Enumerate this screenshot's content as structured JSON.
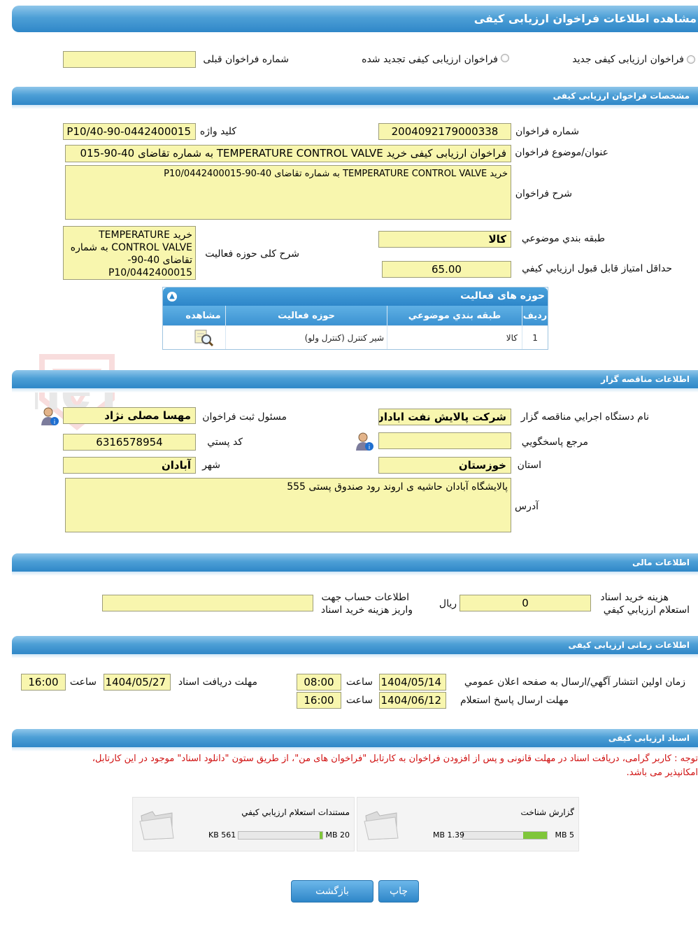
{
  "header": {
    "title": "مشاهده اطلاعات فراخوان ارزيابی کيفی"
  },
  "type_row": {
    "radio_new": "فراخوان ارزيابی کيفی جديد",
    "radio_renew": "فراخوان ارزيابی کيفی تجديد شده",
    "prev_label": "شماره فراخوان قبلی",
    "prev_value": ""
  },
  "sections": {
    "specs": "مشخصات فراخوان ارزيابی کيفی",
    "organizer": "اطلاعات مناقصه گزار",
    "financial": "اطلاعات مالی",
    "timing": "اطلاعات زمانی ارزيابی کيفی",
    "documents": "اسناد ارزيابی کيفی"
  },
  "specs": {
    "number_label": "شماره فراخوان",
    "number_value": "2004092179000338",
    "keyword_label": "کليد واژه",
    "keyword_value": "P10/40-90-0442400015",
    "subject_label": "عنوان/موضوع فراخوان",
    "subject_value": "فراخوان ارزيابی کيفی خريد TEMPERATURE CONTROL VALVE به شماره تقاضای 40-90-015",
    "desc_label": "شرح فراخوان",
    "desc_value": "خريد TEMPERATURE CONTROL VALVE به شماره تقاضای 40-90-P10/0442400015",
    "category_label": "طبقه بندي موضوعي",
    "category_value": "کالا",
    "activity_desc_label": "شرح کلی حوزه فعاليت",
    "activity_desc_value": "خريد TEMPERATURE CONTROL VALVE به شماره تقاضای 40-90-P10/0442400015",
    "min_score_label": "حداقل امتياز قابل قبول ارزيابي کيفي",
    "min_score_value": "65.00"
  },
  "activities": {
    "title": "حوزه های فعاليت",
    "columns": [
      "رديف",
      "طبقه بندي موضوعي",
      "حوزه فعاليت",
      "مشاهده"
    ],
    "rows": [
      {
        "index": "1",
        "category": "کالا",
        "activity": "شير کنترل (کنترل ولو)"
      }
    ]
  },
  "organizer": {
    "org_label": "نام دستگاه اجرايي مناقصه گزار",
    "org_value": "شرکت پالايش نفت ابادان",
    "registrar_label": "مسئول ثبت فراخوان",
    "registrar_value": "مهسا مصلی نژاد",
    "responder_label": "مرجع پاسخگويي",
    "responder_value": "",
    "postal_label": "کد پستي",
    "postal_value": "6316578954",
    "province_label": "استان",
    "province_value": "خوزستان",
    "city_label": "شهر",
    "city_value": "آبادان",
    "address_label": "آدرس",
    "address_value": "پالايشگاه آبادان حاشيه ی اروند رود صندوق پستی 555"
  },
  "financial": {
    "fee_label_1": "هزينه خريد اسناد",
    "fee_label_2": "استعلام ارزيابي کيفي",
    "fee_value": "0",
    "fee_unit": "ريال",
    "account_label_1": "اطلاعات حساب جهت",
    "account_label_2": "واريز هزينه خريد اسناد",
    "account_value": ""
  },
  "timing": {
    "publish_label": "زمان اولين انتشار آگهي/ارسال به صفحه اعلان عمومي",
    "publish_date": "1404/05/14",
    "publish_time": "08:00",
    "receive_label": "مهلت دريافت اسناد",
    "receive_date": "1404/05/27",
    "receive_time": "16:00",
    "reply_label": "مهلت ارسال پاسخ استعلام",
    "reply_date": "1404/06/12",
    "reply_time": "16:00",
    "time_label": "ساعت"
  },
  "documents": {
    "notice_line1": "توجه : کاربر گرامی، دريافت اسناد در مهلت قانونی و پس از افزودن فراخوان به کارتابل \"فراخوان های من\"، از طريق ستون \"دانلود اسناد\" موجود در اين کارتابل،",
    "notice_line2": "امکانپذير می باشد.",
    "files": [
      {
        "name": "گزارش شناخت",
        "max": "5 MB",
        "size": "1.39 MB",
        "progress": 0.28
      },
      {
        "name": "مستندات استعلام ارزيابي کيفي",
        "max": "20 MB",
        "size": "561 KB",
        "progress": 0.03
      }
    ]
  },
  "buttons": {
    "print": "چاپ",
    "back": "بازگشت"
  },
  "watermark": "AriaTender.neT",
  "colors": {
    "accent": "#2f87c8",
    "field_bg": "#f8f6ae",
    "notice": "#d01010",
    "progress": "#7fc63a"
  }
}
